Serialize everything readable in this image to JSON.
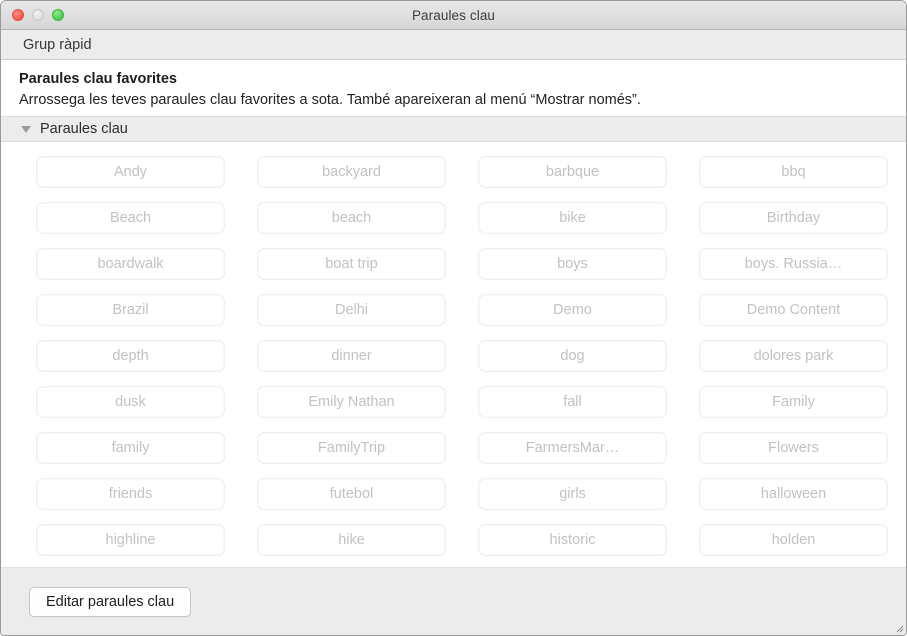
{
  "window": {
    "title": "Paraules clau",
    "controls": {
      "close": "close-button",
      "minimize": "minimize-button",
      "zoom": "zoom-button"
    }
  },
  "toolbar": {
    "quick_group_label": "Grup ràpid"
  },
  "intro": {
    "heading": "Paraules clau favorites",
    "description": "Arrossega les teves paraules clau favorites a sota. També apareixeran al menú “Mostrar només”."
  },
  "group": {
    "title": "Paraules clau",
    "expanded": true,
    "disclosure_icon": "triangle-down-icon"
  },
  "keywords": [
    "Andy",
    "backyard",
    "barbque",
    "bbq",
    "Beach",
    "beach",
    "bike",
    "Birthday",
    "boardwalk",
    "boat trip",
    "boys",
    "boys. Russia…",
    "Brazil",
    "Delhi",
    "Demo",
    "Demo Content",
    "depth",
    "dinner",
    "dog",
    "dolores park",
    "dusk",
    "Emily Nathan",
    "fall",
    "Family",
    "family",
    "FamilyTrip",
    "FarmersMar…",
    "Flowers",
    "friends",
    "futebol",
    "girls",
    "halloween",
    "highline",
    "hike",
    "historic",
    "holden"
  ],
  "footer": {
    "edit_keywords_label": "Editar paraules clau"
  },
  "colors": {
    "titlebar_top": "#e8e8e8",
    "titlebar_bottom": "#d6d6d6",
    "band_gray": "#ececec",
    "content_white": "#ffffff",
    "keyword_text": "#c2c2c4",
    "keyword_border": "#efeff0",
    "close_red": "#f35a4e",
    "minimize_gray": "#dcdcdc",
    "zoom_green": "#4cc94a"
  }
}
